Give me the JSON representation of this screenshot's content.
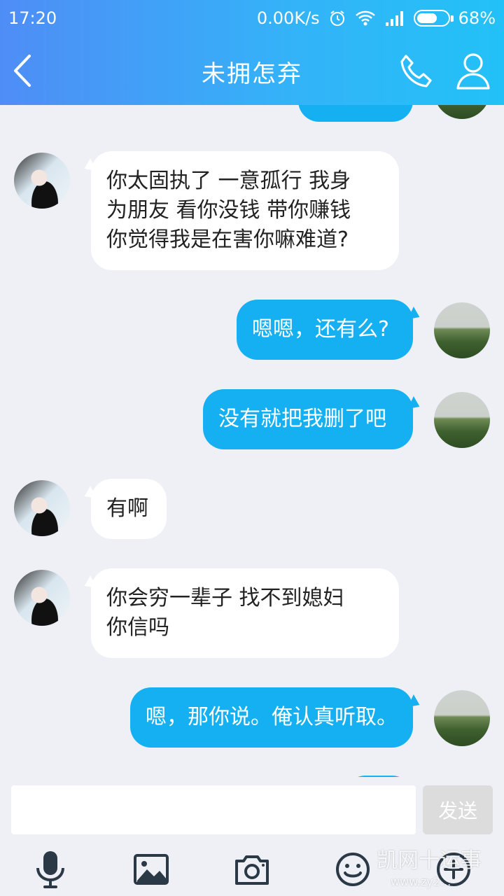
{
  "status_bar": {
    "time": "17:20",
    "network_speed": "0.00K/s",
    "battery_percent": "68%",
    "battery_level": 0.68,
    "icons": [
      "alarm-icon",
      "wifi-icon",
      "signal-icon",
      "battery-icon"
    ]
  },
  "header": {
    "title": "未拥怎弃",
    "back_icon": "chevron-left-icon",
    "call_icon": "phone-icon",
    "profile_icon": "person-icon"
  },
  "messages": [
    {
      "side": "out",
      "text": "",
      "partial": true
    },
    {
      "side": "in",
      "text": "你太固执了 一意孤行 我身\n为朋友 看你没钱 带你赚钱\n你觉得我是在害你嘛难道?"
    },
    {
      "side": "out",
      "text": "嗯嗯，还有么?"
    },
    {
      "side": "out",
      "text": "没有就把我删了吧"
    },
    {
      "side": "in",
      "text": "有啊"
    },
    {
      "side": "in",
      "text": "你会穷一辈子 找不到媳妇\n你信吗"
    },
    {
      "side": "out",
      "text": "嗯，那你说。俺认真听取。"
    },
    {
      "side": "out",
      "text": "",
      "partial": true
    }
  ],
  "input": {
    "value": "",
    "placeholder": "",
    "send_label": "发送"
  },
  "toolbar": {
    "items": [
      "microphone-icon",
      "image-icon",
      "camera-icon",
      "emoji-icon",
      "plus-icon"
    ]
  },
  "watermark": {
    "main": "凯网十运事",
    "sub": "www.zy2..."
  },
  "colors": {
    "header_gradient_start": "#4f8df6",
    "header_gradient_end": "#22c1f7",
    "outgoing_bubble": "#14b0f2",
    "incoming_bubble": "#ffffff",
    "chat_background": "#eef0f6",
    "send_button_disabled": "#dcdcdc"
  }
}
